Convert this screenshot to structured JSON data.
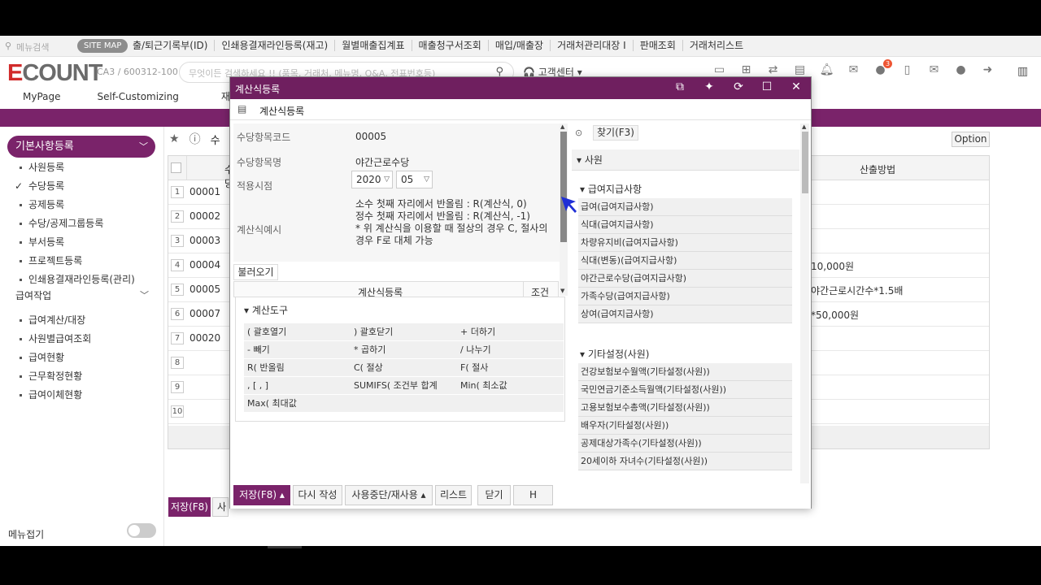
{
  "topbar": {
    "search_placeholder": "메뉴검색",
    "sitemap": "SITE MAP",
    "links": [
      "출/퇴근기록부(ID)",
      "인쇄용결재라인등록(재고)",
      "월별매출집계표",
      "매출청구서조회",
      "매입/매출장",
      "거래처관리대장 I",
      "판매조회",
      "거래처리스트"
    ]
  },
  "header": {
    "logo_e": "E",
    "logo_rest": "COUNT",
    "company": "CA3 / 600312-100",
    "search_placeholder": "무엇이든 검색하세요 !! (품목, 거래처, 메뉴명, Q&A, 전표번호등)",
    "help": "고객센터",
    "notification_count": "3"
  },
  "mainnav": [
    "MyPage",
    "Self-Customizing",
    "재고"
  ],
  "sidebar": {
    "group1": "기본사항등록",
    "items1": [
      "사원등록",
      "수당등록",
      "공제등록",
      "수당/공제그룹등록",
      "부서등록",
      "프로젝트등록",
      "인쇄용결재라인등록(관리)"
    ],
    "group2": "급여작업",
    "items2": [
      "급여계산/대장",
      "사원별급여조회",
      "급여현황",
      "근무확정현황",
      "급여이체현황"
    ],
    "menu_fold": "메뉴접기"
  },
  "main": {
    "title_partial": "수",
    "option": "Option",
    "col_code": "수당",
    "col_calc": "산출방법",
    "rows": [
      {
        "num": "1",
        "code": "00001",
        "calc": ""
      },
      {
        "num": "2",
        "code": "00002",
        "calc": ""
      },
      {
        "num": "3",
        "code": "00003",
        "calc": ""
      },
      {
        "num": "4",
        "code": "00004",
        "calc": "10,000원"
      },
      {
        "num": "5",
        "code": "00005",
        "calc": "야간근로시간수*1.5배"
      },
      {
        "num": "6",
        "code": "00007",
        "calc": "*50,000원"
      },
      {
        "num": "7",
        "code": "00020",
        "calc": ""
      },
      {
        "num": "8",
        "code": "",
        "calc": ""
      },
      {
        "num": "9",
        "code": "",
        "calc": ""
      },
      {
        "num": "10",
        "code": "",
        "calc": ""
      }
    ],
    "save": "저장(F8)",
    "save2": "사"
  },
  "modal": {
    "title": "계산식등록",
    "subtitle": "계산식등록",
    "form": {
      "code_label": "수당항목코드",
      "code_value": "00005",
      "name_label": "수당항목명",
      "name_value": "야간근로수당",
      "date_label": "적용시점",
      "year": "2020",
      "month": "05",
      "example_label": "계산식예시",
      "example_lines": [
        "소수 첫째 자리에서 반올림 : R(계산식, 0)",
        "정수 첫째 자리에서 반올림 : R(계산식, -1)",
        "* 위 계산식을 이용할 때 절상의 경우 C, 절사의",
        "경우 F로 대체 가능"
      ]
    },
    "load_button": "불러오기",
    "subgrid": {
      "col1": "계산식등록",
      "col2": "조건"
    },
    "tools": {
      "header": "계산도구",
      "rows": [
        [
          "( 괄호열기",
          ") 괄호닫기",
          "+ 더하기"
        ],
        [
          "- 빼기",
          "* 곱하기",
          "/ 나누기"
        ],
        [
          "R( 반올림",
          "C( 절상",
          "F( 절사"
        ],
        [
          ", [ , ]",
          "SUMIFS( 조건부 합계",
          "Min( 최소값"
        ],
        [
          "Max( 최대값",
          "",
          ""
        ]
      ]
    },
    "right": {
      "find": "찾기(F3)",
      "section": "사원",
      "group1": "급여지급사항",
      "items1": [
        "급여(급여지급사항)",
        "식대(급여지급사항)",
        "차량유지비(급여지급사항)",
        "식대(변동)(급여지급사항)",
        "야간근로수당(급여지급사항)",
        "가족수당(급여지급사항)",
        "상여(급여지급사항)"
      ],
      "group2": "기타설정(사원)",
      "items2": [
        "건강보험보수월액(기타설정(사원))",
        "국민연금기준소득월액(기타설정(사원))",
        "고용보험보수총액(기타설정(사원))",
        "배우자(기타설정(사원))",
        "공제대상가족수(기타설정(사원))",
        "20세이하 자녀수(기타설정(사원))"
      ]
    },
    "footer": {
      "save": "저장(F8)",
      "rewrite": "다시 작성",
      "suspend": "사용중단/재사용",
      "list": "리스트",
      "close": "닫기",
      "h": "H"
    }
  },
  "colors": {
    "brand": "#7a236a",
    "modal_header": "#6f1f5f",
    "logo_red": "#d12b2b",
    "cursor": "#1f2fd6"
  }
}
